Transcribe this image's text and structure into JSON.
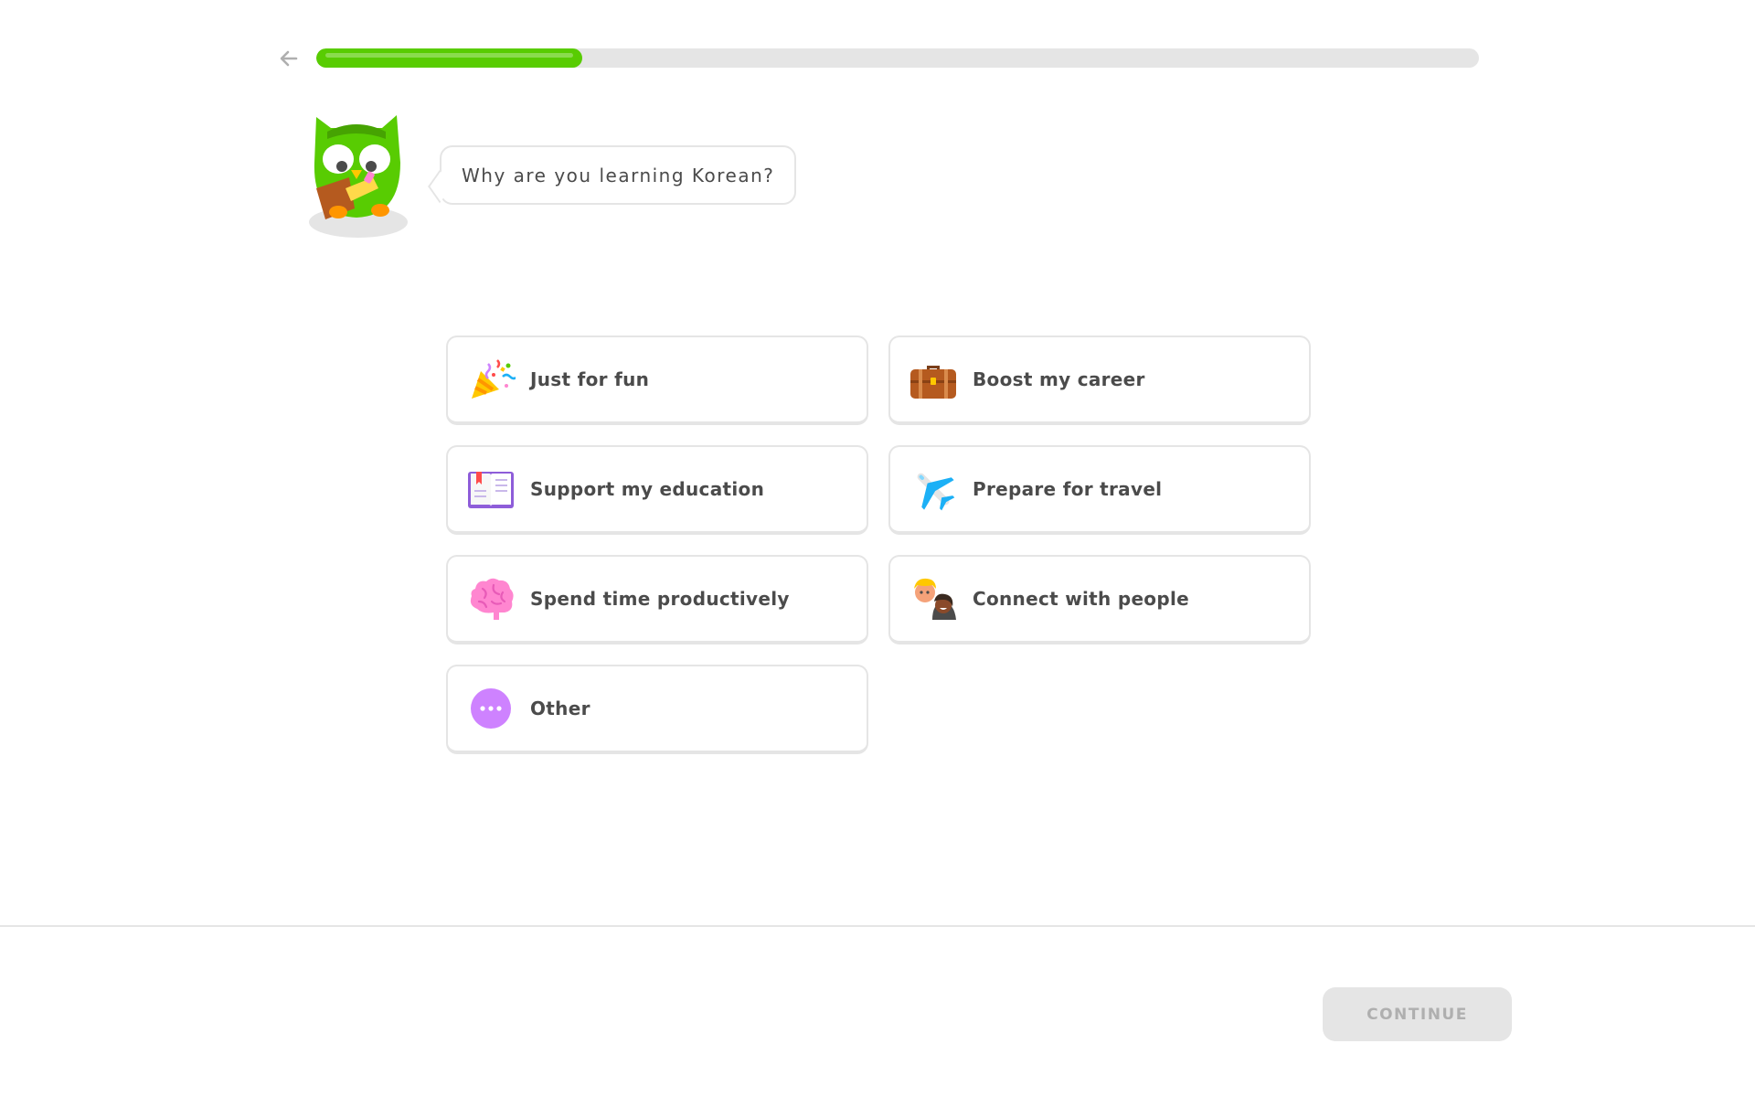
{
  "progress": {
    "fraction": 0.229
  },
  "icons": {
    "back": "arrow-left-icon",
    "mascot": "owl-mascot"
  },
  "colors": {
    "accent": "#58cc02",
    "track": "#e5e5e5",
    "text": "#4b4b4b",
    "disabled_text": "#afafaf"
  },
  "question": "Why are you learning Korean?",
  "options": [
    {
      "label": "Just for fun",
      "icon": "party-popper-icon"
    },
    {
      "label": "Boost my career",
      "icon": "briefcase-icon"
    },
    {
      "label": "Support my education",
      "icon": "book-icon"
    },
    {
      "label": "Prepare for travel",
      "icon": "airplane-icon"
    },
    {
      "label": "Spend time productively",
      "icon": "brain-icon"
    },
    {
      "label": "Connect with people",
      "icon": "people-icon"
    },
    {
      "label": "Other",
      "icon": "more-dots-icon"
    }
  ],
  "footer": {
    "continue_label": "CONTINUE"
  }
}
